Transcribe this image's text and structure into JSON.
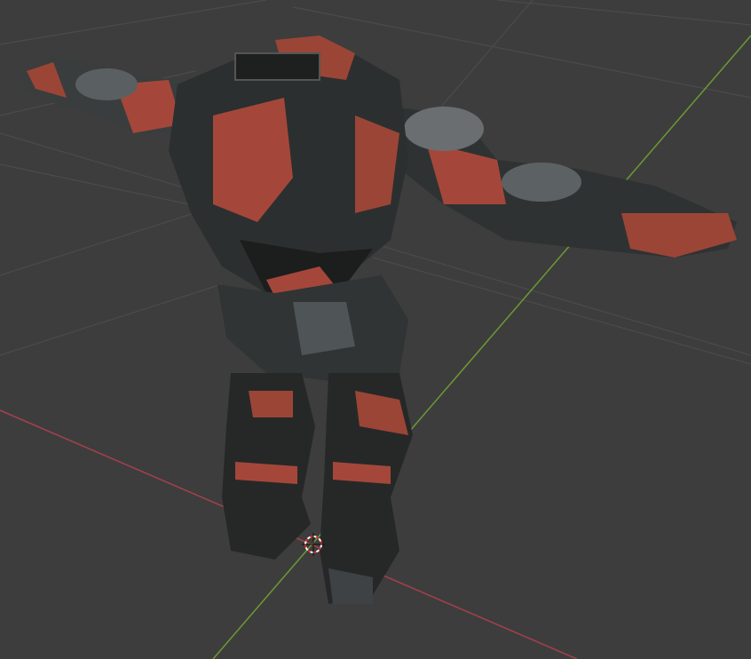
{
  "viewport": {
    "background": "#3d3d3d",
    "grid_color": "#4a4a4a",
    "x_axis_color": "#a6404c",
    "y_axis_color": "#6e9a32",
    "model_accent": "#a4473a",
    "model_dark": "#2a2c2c"
  }
}
